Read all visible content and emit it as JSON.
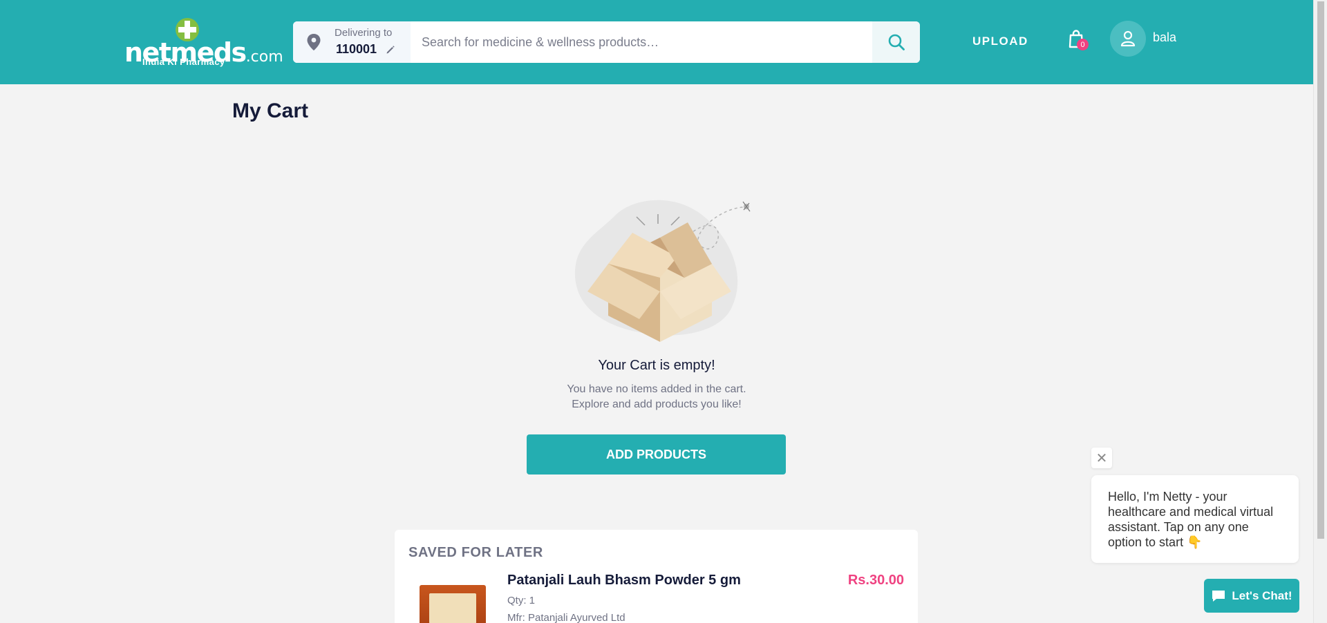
{
  "header": {
    "logo_text": "netmeds",
    "logo_suffix": ".com",
    "logo_tagline": "India Ki Pharmacy",
    "delivering_label": "Delivering to",
    "pincode": "110001",
    "search_placeholder": "Search for medicine & wellness products…",
    "upload_label": "UPLOAD",
    "cart_count": "0",
    "username": "bala",
    "brand_color": "#24aeb1",
    "accent_color": "#ef4281"
  },
  "main": {
    "title": "My Cart",
    "empty_title": "Your Cart is empty!",
    "empty_line1": "You have no items added in the cart.",
    "empty_line2": "Explore and add products you like!",
    "add_button": "ADD PRODUCTS"
  },
  "saved": {
    "title": "SAVED FOR LATER",
    "items": [
      {
        "name": "Patanjali Lauh Bhasm Powder 5 gm",
        "qty": "Qty: 1",
        "mfr": "Mfr: Patanjali Ayurved Ltd",
        "price": "Rs.30.00"
      }
    ]
  },
  "chat": {
    "close_glyph": "✕",
    "message": "Hello, I'm Netty - your healthcare and medical virtual assistant. Tap on any one option to start 👇",
    "button_label": "Let's Chat!"
  }
}
